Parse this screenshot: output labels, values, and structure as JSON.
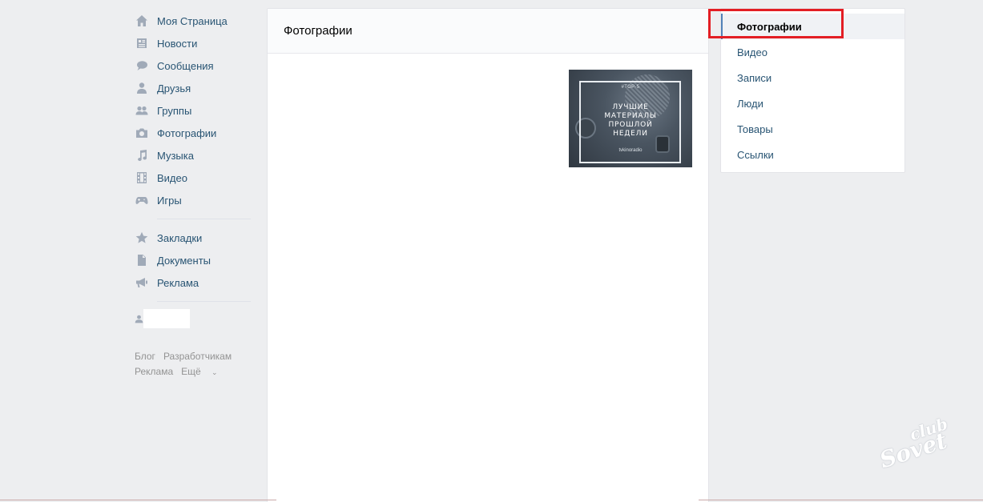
{
  "left_nav": {
    "items": [
      {
        "label": "Моя Страница",
        "icon": "home-icon"
      },
      {
        "label": "Новости",
        "icon": "news-icon"
      },
      {
        "label": "Сообщения",
        "icon": "messages-icon"
      },
      {
        "label": "Друзья",
        "icon": "friends-icon"
      },
      {
        "label": "Группы",
        "icon": "groups-icon"
      },
      {
        "label": "Фотографии",
        "icon": "camera-icon"
      },
      {
        "label": "Музыка",
        "icon": "music-icon"
      },
      {
        "label": "Видео",
        "icon": "video-icon"
      },
      {
        "label": "Игры",
        "icon": "gamepad-icon"
      }
    ],
    "items2": [
      {
        "label": "Закладки",
        "icon": "star-icon"
      },
      {
        "label": "Документы",
        "icon": "document-icon"
      },
      {
        "label": "Реклама",
        "icon": "megaphone-icon"
      }
    ],
    "footer": {
      "blog": "Блог",
      "developers": "Разработчикам",
      "ads": "Реклама",
      "more": "Ещё"
    }
  },
  "main": {
    "title": "Фотографии",
    "photo": {
      "top_text": "#TOP-5",
      "main_text_1": "ЛУЧШИЕ",
      "main_text_2": "МАТЕРИАЛЫ",
      "main_text_3": "ПРОШЛОЙ",
      "main_text_4": "НЕДЕЛИ",
      "bottom_text": "tvkinoradio"
    }
  },
  "right_menu": {
    "items": [
      "Фотографии",
      "Видео",
      "Записи",
      "Люди",
      "Товары",
      "Ссылки"
    ],
    "active_index": 0
  },
  "watermark": {
    "line1": "club",
    "line2": "Sovet"
  },
  "colors": {
    "link": "#285473",
    "highlight": "#e31e24",
    "background": "#edeef0"
  }
}
